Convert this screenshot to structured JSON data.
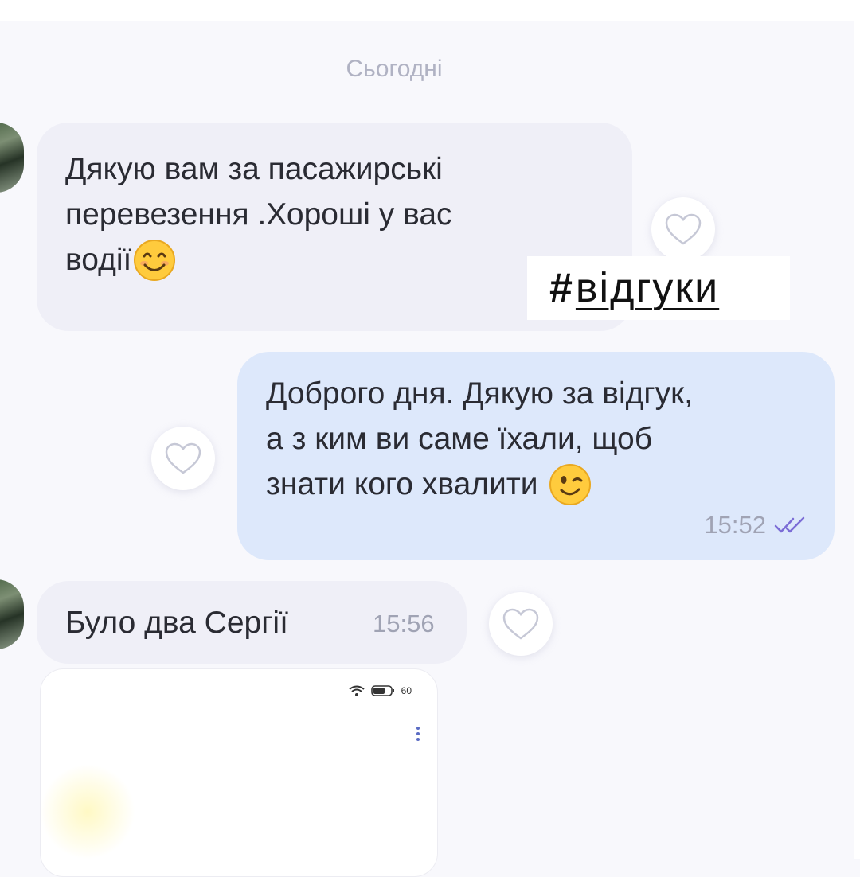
{
  "date_separator": "Сьогодні",
  "hashtag": {
    "hash": "#",
    "text": "відгуки"
  },
  "messages": [
    {
      "direction": "incoming",
      "lines": [
        "Дякую вам за пасажирські",
        "перевезення .Хороші у вас",
        "водії"
      ],
      "emoji": "smiling-face-emoji",
      "liked": false
    },
    {
      "direction": "outgoing",
      "lines": [
        "Доброго дня. Дякую за відгук,",
        "а з ким ви саме їхали, щоб",
        "знати кого хвалити"
      ],
      "emoji": "winking-face-emoji",
      "time": "15:52",
      "status": "read-double-check",
      "liked": false
    },
    {
      "direction": "incoming",
      "lines": [
        "Було два Сергії"
      ],
      "time": "15:56",
      "liked": false
    }
  ],
  "attached_screenshot": {
    "battery": "60"
  },
  "colors": {
    "incoming_bubble": "#efeff7",
    "outgoing_bubble": "#dde8fb",
    "read_check": "#7b6cd6"
  }
}
